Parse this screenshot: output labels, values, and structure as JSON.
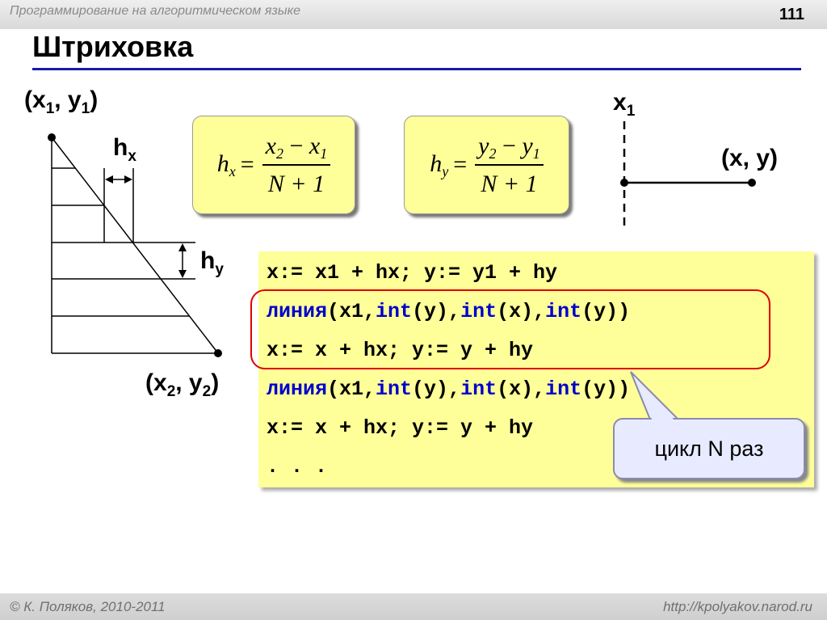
{
  "header": {
    "course": "Программирование на алгоритмическом языке",
    "page_number": "111"
  },
  "title": "Штриховка",
  "diagram": {
    "top_point_label": {
      "base_x": "(x",
      "sub1": "1",
      "mid": ", y",
      "sub2": "1",
      "end": ")"
    },
    "bottom_point_label": {
      "base_x": "(x",
      "sub1": "2",
      "mid": ", y",
      "sub2": "2",
      "end": ")"
    },
    "hx_label": {
      "base": "h",
      "sub": "x"
    },
    "hy_label": {
      "base": "h",
      "sub": "y"
    }
  },
  "formula_hx": {
    "lhs": "h",
    "lhs_sub": "x",
    "eq": "=",
    "num_a": "x",
    "num_a_sub": "2",
    "minus": " − ",
    "num_b": "x",
    "num_b_sub": "1",
    "den": "N + 1"
  },
  "formula_hy": {
    "lhs": "h",
    "lhs_sub": "y",
    "eq": "=",
    "num_a": "y",
    "num_a_sub": "2",
    "minus": " − ",
    "num_b": "y",
    "num_b_sub": "1",
    "den": "N + 1"
  },
  "right_diagram": {
    "x1_label": {
      "base": "x",
      "sub": "1"
    },
    "point_label": "(x, y)"
  },
  "code": {
    "line1": "x:= x1 + hx; y:= y1 + hy",
    "line2": {
      "kw1": "линия",
      "a": "(x1,",
      "kw2": "int",
      "b": "(y),",
      "kw3": "int",
      "c": "(x),",
      "kw4": "int",
      "d": "(y))"
    },
    "line3": "x:= x + hx; y:= y + hy",
    "line4": {
      "kw1": "линия",
      "a": "(x1,",
      "kw2": "int",
      "b": "(y),",
      "kw3": "int",
      "c": "(x),",
      "kw4": "int",
      "d": "(y))"
    },
    "line5": "x:= x + hx; y:= y + hy",
    "line6": ". . ."
  },
  "callout": "цикл N раз",
  "footer": {
    "author": "© К. Поляков, 2010-2011",
    "url": "http://kpolyakov.narod.ru"
  }
}
